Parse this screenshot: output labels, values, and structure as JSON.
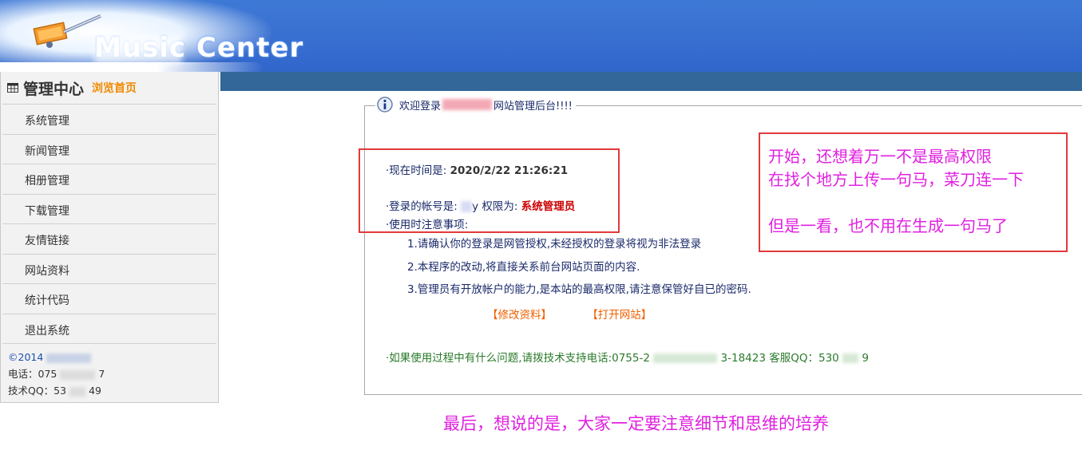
{
  "header": {
    "logo_text": "Music Center"
  },
  "sidebar": {
    "title": "管理中心",
    "home_link": "浏览首页",
    "items": [
      {
        "label": "系统管理"
      },
      {
        "label": "新闻管理"
      },
      {
        "label": "相册管理"
      },
      {
        "label": "下载管理"
      },
      {
        "label": "友情链接"
      },
      {
        "label": "网站资料"
      },
      {
        "label": "统计代码"
      },
      {
        "label": "退出系统"
      }
    ],
    "footer": {
      "copyright": "©2014",
      "phone_label": "电话：075",
      "phone_tail": "7",
      "qq_label": "技术QQ：53",
      "qq_tail": "49"
    }
  },
  "welcome": {
    "prefix": "欢迎登录",
    "suffix": "网站管理后台!!!!"
  },
  "info": {
    "time_label": "·现在时间是: ",
    "time_value": "2020/2/22 21:26:21",
    "account_label": "·登录的帐号是:",
    "account_tail": "y",
    "permission_label": " 权限为: ",
    "permission_value": "系统管理员",
    "notes_title": "·使用时注意事项:",
    "notes": [
      "1.请确认你的登录是网管授权,未经授权的登录将视为非法登录",
      "2.本程序的改动,将直接关系前台网站页面的内容.",
      "3.管理员有开放帐户的能力,是本站的最高权限,请注意保管好自已的密码."
    ]
  },
  "links": {
    "edit_profile": "【修改资料】",
    "open_site": "【打开网站】"
  },
  "support": {
    "prefix": "·如果使用过程中有什么问题,请拨技术支持电话:0755-2",
    "mid": "3-18423 客服QQ：530",
    "tail": "9"
  },
  "annotation": {
    "lines": [
      "开始，还想着万一不是最高权限",
      "在找个地方上传一句马，菜刀连一下",
      "但是一看，也不用在生成一句马了"
    ],
    "footer": "最后，想说的是，大家一定要注意细节和思维的培养"
  },
  "colors": {
    "header_blue": "#3166cb",
    "strip": "#336699",
    "annotation_magenta": "#e020e0",
    "annotation_border": "#e23a3a",
    "link_orange": "#f06000",
    "role_red": "#cc0000"
  }
}
